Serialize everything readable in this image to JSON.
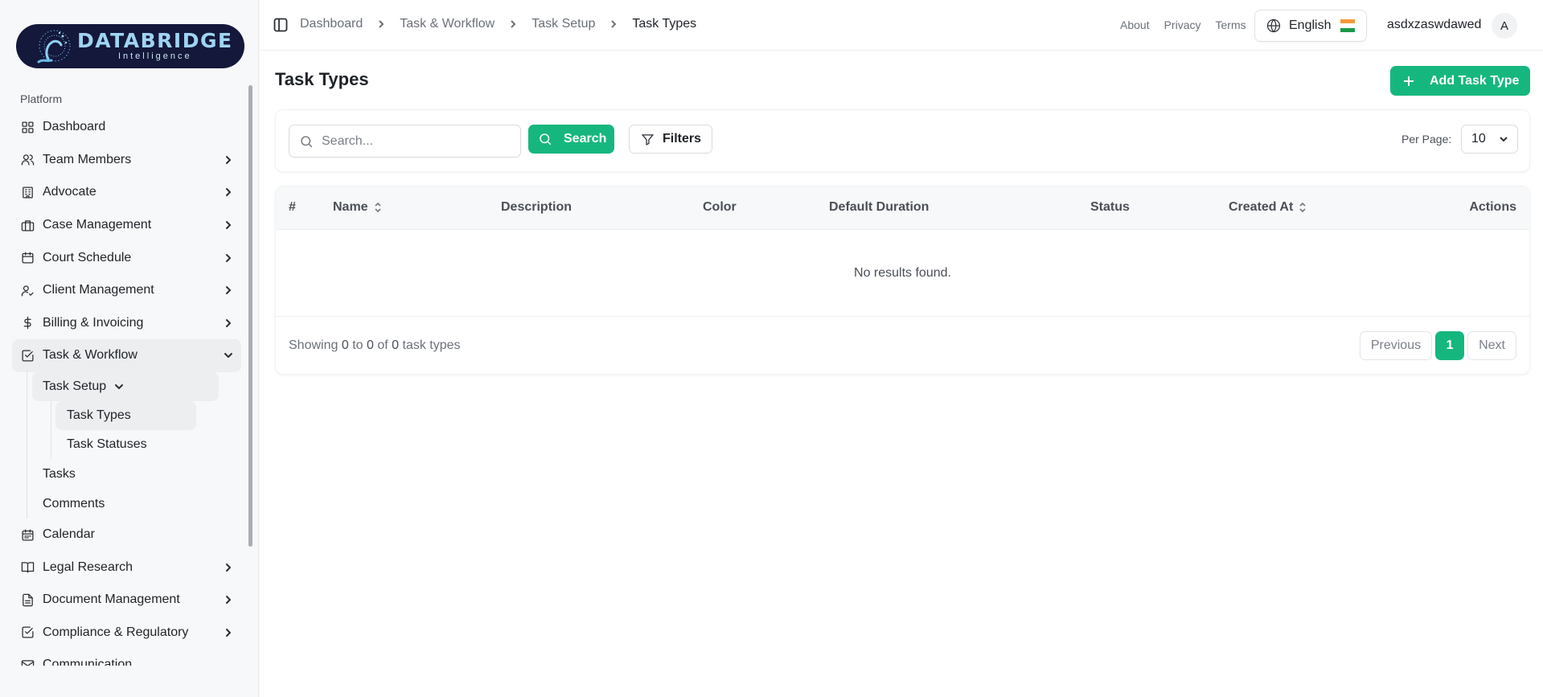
{
  "brand": {
    "name": "DATABRIDGE",
    "tagline": "Intelligence"
  },
  "sidebar": {
    "section_label": "Platform",
    "items": [
      {
        "label": "Dashboard",
        "icon": "dashboard-grid-icon"
      },
      {
        "label": "Team Members",
        "icon": "users-icon"
      },
      {
        "label": "Advocate",
        "icon": "building-icon"
      },
      {
        "label": "Case Management",
        "icon": "briefcase-icon"
      },
      {
        "label": "Court Schedule",
        "icon": "calendar-icon"
      },
      {
        "label": "Client Management",
        "icon": "user-check-icon"
      },
      {
        "label": "Billing & Invoicing",
        "icon": "dollar-icon"
      },
      {
        "label": "Task & Workflow",
        "icon": "checkbox-icon"
      }
    ],
    "task_workflow_sub": {
      "task_setup": "Task Setup",
      "task_types": "Task Types",
      "task_statuses": "Task Statuses",
      "tasks": "Tasks",
      "comments": "Comments"
    },
    "items_after": [
      {
        "label": "Calendar",
        "icon": "calendar-days-icon"
      },
      {
        "label": "Legal Research",
        "icon": "book-open-icon"
      },
      {
        "label": "Document Management",
        "icon": "file-text-icon"
      },
      {
        "label": "Compliance & Regulatory",
        "icon": "check-square-icon"
      },
      {
        "label": "Communication",
        "icon": "mail-icon"
      }
    ]
  },
  "header": {
    "breadcrumb": [
      "Dashboard",
      "Task & Workflow",
      "Task Setup",
      "Task Types"
    ],
    "links": [
      "About",
      "Privacy",
      "Terms"
    ],
    "language": "English",
    "username": "asdxzaswdawed",
    "avatar_initial": "A"
  },
  "page": {
    "title": "Task Types",
    "add_button": "Add Task Type",
    "search_placeholder": "Search...",
    "search_button": "Search",
    "filters_button": "Filters",
    "per_page_label": "Per Page:",
    "per_page_value": "10"
  },
  "table": {
    "columns": [
      "#",
      "Name",
      "Description",
      "Color",
      "Default Duration",
      "Status",
      "Created At",
      "Actions"
    ],
    "empty_message": "No results found.",
    "showing": {
      "prefix": "Showing",
      "from": "0",
      "to_word": "to",
      "to": "0",
      "of_word": "of",
      "total": "0",
      "suffix": "task types"
    },
    "pagination": {
      "previous": "Previous",
      "current": "1",
      "next": "Next"
    }
  },
  "colors": {
    "accent": "#16b77e",
    "logo_bg": "#14183a"
  }
}
